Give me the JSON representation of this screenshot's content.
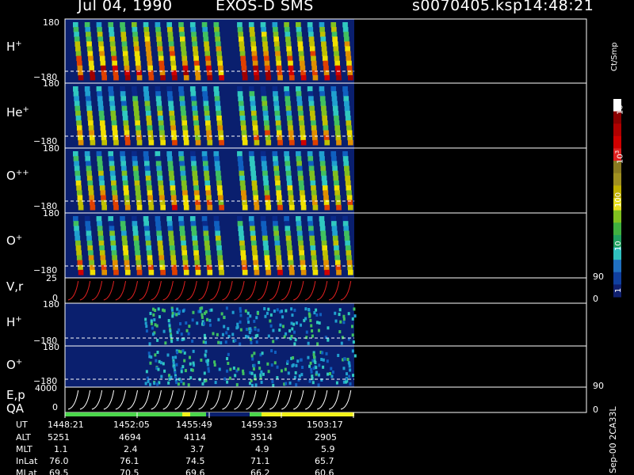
{
  "header": {
    "date": "Jul 04, 1990",
    "instrument": "EXOS-D SMS",
    "file": "s0070405.ksp",
    "time": "14:48:21"
  },
  "chart_data": {
    "type": "heatmap",
    "panels": [
      {
        "label": "H",
        "ion": "+",
        "ylim": [
          -180,
          180
        ],
        "ticks": [
          "180",
          "−180"
        ]
      },
      {
        "label": "He",
        "ion": "+",
        "ylim": [
          -180,
          180
        ],
        "ticks": [
          "180",
          "−180"
        ]
      },
      {
        "label": "O",
        "ion": "++",
        "ylim": [
          -180,
          180
        ],
        "ticks": [
          "180",
          "−180"
        ]
      },
      {
        "label": "O",
        "ion": "+",
        "ylim": [
          -180,
          180
        ],
        "ticks": [
          "180",
          "−180"
        ]
      },
      {
        "label": "V,r",
        "ion": "",
        "ylim": [
          0,
          25
        ],
        "ticks": [
          "25",
          "0"
        ],
        "right_ticks": [
          "90",
          "0"
        ]
      },
      {
        "label": "H",
        "ion": "+",
        "ylim": [
          -180,
          180
        ],
        "ticks": [
          "180",
          "−180"
        ]
      },
      {
        "label": "O",
        "ion": "+",
        "ylim": [
          -180,
          180
        ],
        "ticks": [
          "180",
          "−180"
        ]
      },
      {
        "label": "E,p",
        "ion": "",
        "ylim": [
          0,
          4000
        ],
        "ticks": [
          "4000",
          "0"
        ],
        "right_ticks": [
          "90",
          "0"
        ]
      }
    ],
    "qa_label": "QA",
    "colorbar": {
      "title": "Ct/Smp",
      "labels": [
        "10",
        "4",
        "10",
        "3",
        "100",
        "10",
        "1"
      ]
    },
    "ephemeris": {
      "rows": [
        "UT",
        "ALT",
        "MLT",
        "InLat",
        "MLat"
      ],
      "columns": [
        [
          "1448:21",
          "5251",
          "1.1",
          "76.0",
          "69.5"
        ],
        [
          "1452:05",
          "4694",
          "2.4",
          "76.1",
          "70.5"
        ],
        [
          "1455:49",
          "4114",
          "3.7",
          "74.5",
          "69.6"
        ],
        [
          "1459:33",
          "3514",
          "4.9",
          "71.1",
          "66.2"
        ],
        [
          "1503:17",
          "2905",
          "5.9",
          "65.7",
          "60.6"
        ]
      ]
    },
    "footer": "Sep-00  2CA33L"
  },
  "colors": {
    "background": "#000000",
    "panel": "#0a1f6e",
    "qa_green": "#4cd64c",
    "qa_yellow": "#f2f21a"
  }
}
